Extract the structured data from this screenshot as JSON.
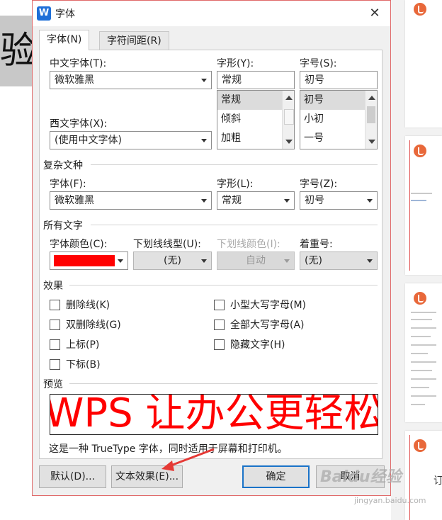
{
  "background": {
    "doc_word": "验",
    "thumb_text": "订"
  },
  "dialog": {
    "title": "字体",
    "app_icon_letter": "W",
    "close_glyph": "✕",
    "tabs": [
      {
        "label": "字体(N)"
      },
      {
        "label": "字符间距(R)"
      }
    ],
    "chinese_font": {
      "label": "中文字体(T):",
      "value": "微软雅黑"
    },
    "western_font": {
      "label": "西文字体(X):",
      "value": "(使用中文字体)"
    },
    "style": {
      "label": "字形(Y):",
      "value": "常规",
      "options": [
        "常规",
        "倾斜",
        "加粗"
      ]
    },
    "size": {
      "label": "字号(S):",
      "value": "初号",
      "options": [
        "初号",
        "小初",
        "一号"
      ]
    },
    "complex": {
      "section": "复杂文种",
      "font": {
        "label": "字体(F):",
        "value": "微软雅黑"
      },
      "style": {
        "label": "字形(L):",
        "value": "常规"
      },
      "size": {
        "label": "字号(Z):",
        "value": "初号"
      }
    },
    "all_text": {
      "section": "所有文字",
      "font_color": {
        "label": "字体颜色(C):",
        "color": "#ff0000"
      },
      "underline_type": {
        "label": "下划线线型(U):",
        "value": "(无)"
      },
      "underline_color": {
        "label": "下划线颜色(I):",
        "value": "自动"
      },
      "emphasis": {
        "label": "着重号:",
        "value": "(无)"
      }
    },
    "effects": {
      "section": "效果",
      "strikethrough": "删除线(K)",
      "double_strikethrough": "双删除线(G)",
      "superscript": "上标(P)",
      "subscript": "下标(B)",
      "small_caps": "小型大写字母(M)",
      "all_caps": "全部大写字母(A)",
      "hidden": "隐藏文字(H)"
    },
    "preview": {
      "section": "预览",
      "text": "WPS 让办公更轻松",
      "description": "这是一种 TrueType 字体，同时适用于屏幕和打印机。"
    },
    "buttons": {
      "default": "默认(D)...",
      "text_effect": "文本效果(E)...",
      "ok": "确定",
      "cancel": "取消"
    }
  },
  "watermark": {
    "text": "Baidu经验",
    "url": "jingyan.baidu.com"
  },
  "colors": {
    "accent": "#1a73c8",
    "annotation_arrow": "#e53935",
    "dialog_border": "#e06a6a"
  }
}
